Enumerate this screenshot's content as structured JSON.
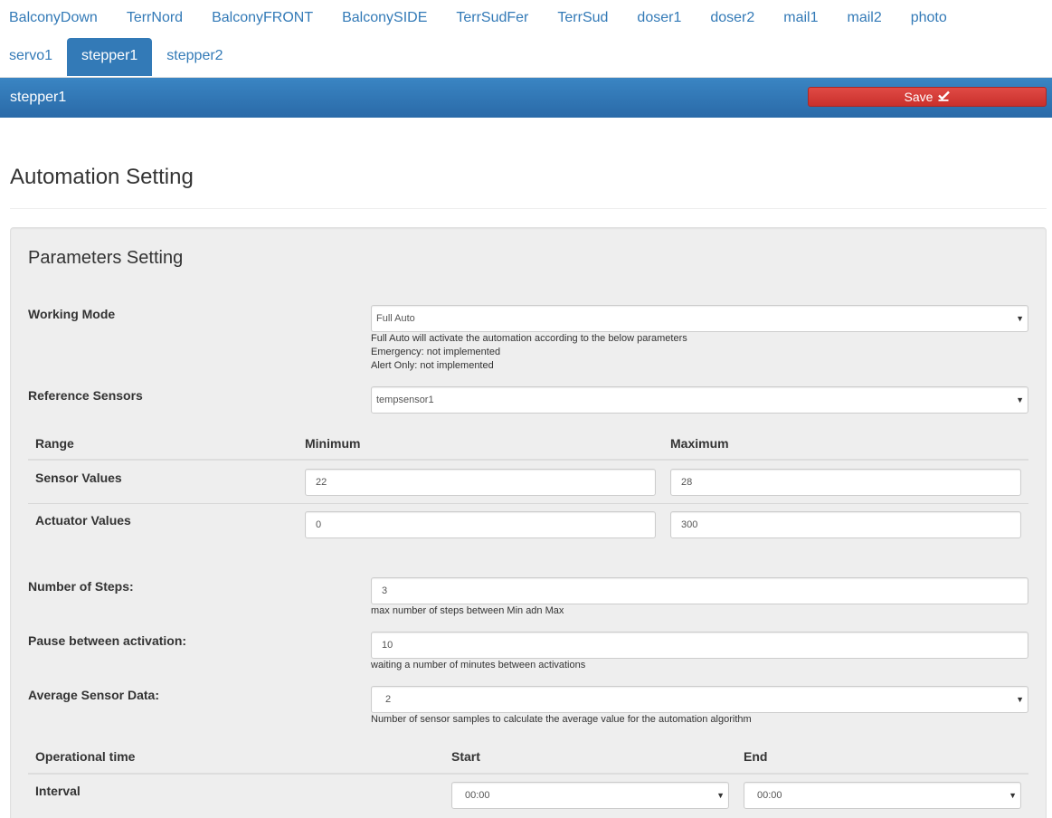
{
  "tabs": {
    "row1": [
      "BalconyDown",
      "TerrNord",
      "BalconyFRONT",
      "BalconySIDE",
      "TerrSudFer",
      "TerrSud",
      "doser1",
      "doser2",
      "mail1",
      "mail2",
      "photo"
    ],
    "row2": [
      "servo1",
      "stepper1",
      "stepper2"
    ],
    "active": "stepper1"
  },
  "header": {
    "title": "stepper1",
    "save_label": "Save",
    "save_icon": "check-square-icon"
  },
  "page": {
    "title": "Automation Setting"
  },
  "panel": {
    "title": "Parameters Setting"
  },
  "working_mode": {
    "label": "Working Mode",
    "value": "Full Auto",
    "help": [
      "Full Auto will activate the automation according to the below parameters",
      "Emergency: not implemented",
      "Alert Only: not implemented"
    ]
  },
  "reference_sensors": {
    "label": "Reference Sensors",
    "value": "tempsensor1"
  },
  "range_table": {
    "headers": [
      "Range",
      "Minimum",
      "Maximum"
    ],
    "rows": [
      {
        "label": "Sensor Values",
        "min": "22",
        "max": "28"
      },
      {
        "label": "Actuator Values",
        "min": "0",
        "max": "300"
      }
    ]
  },
  "steps": {
    "label": "Number of Steps:",
    "value": "3",
    "help": "max number of steps between Min adn Max"
  },
  "pause": {
    "label": "Pause between activation:",
    "value": "10",
    "help": "waiting a number of minutes between activations"
  },
  "average": {
    "label": "Average Sensor Data:",
    "value": "2",
    "help": "Number of sensor samples to calculate the average value for the automation algorithm"
  },
  "op_time": {
    "headers": [
      "Operational time",
      "Start",
      "End"
    ],
    "rows": [
      {
        "label": "Interval",
        "start": "00:00",
        "end": "00:00"
      }
    ]
  },
  "colors": {
    "accent": "#337ab7",
    "save": "#d9534f",
    "panel": "#eeeeee"
  }
}
